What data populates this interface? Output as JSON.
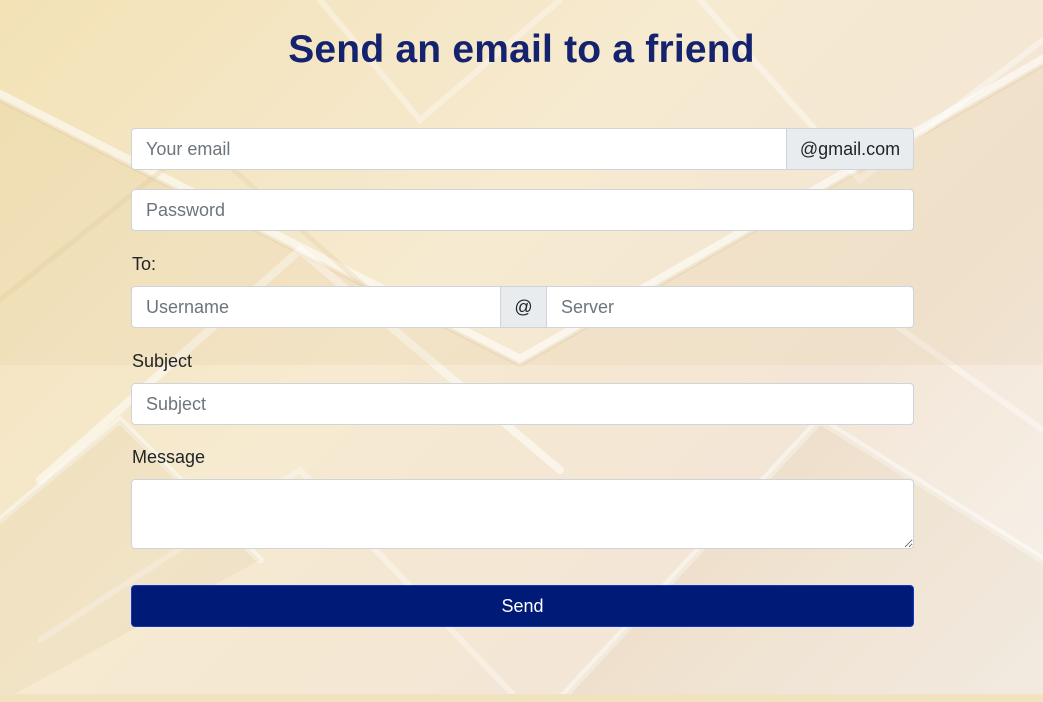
{
  "title": "Send an email to a friend",
  "email": {
    "placeholder": "Your email",
    "value": "",
    "domain_suffix": "@gmail.com"
  },
  "password": {
    "placeholder": "Password",
    "value": ""
  },
  "to": {
    "label": "To:",
    "username_placeholder": "Username",
    "at_symbol": "@",
    "server_placeholder": "Server"
  },
  "subject": {
    "label": "Subject",
    "placeholder": "Subject",
    "value": ""
  },
  "message": {
    "label": "Message",
    "value": ""
  },
  "send_button": {
    "label": "Send"
  },
  "colors": {
    "title": "#15236e",
    "button": "#001a78",
    "addon_bg": "#e9ecef"
  }
}
